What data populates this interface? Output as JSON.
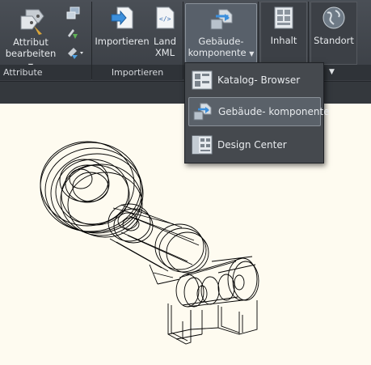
{
  "ribbon": {
    "attribute": {
      "edit_button_line1": "Attribut",
      "edit_button_line2": "bearbeiten",
      "panel_title": "Attribute"
    },
    "import": {
      "import_button": "Importieren",
      "landxml_line1": "Land",
      "landxml_line2": "XML",
      "panel_title": "Importieren"
    },
    "building_component": {
      "line1": "Gebäude-",
      "line2": "komponente"
    },
    "content_button": "Inhalt",
    "location_button": "Standort"
  },
  "dropdown": {
    "items": [
      {
        "label": "Katalog- Browser"
      },
      {
        "label": "Gebäude- komponente"
      },
      {
        "label": "Design Center"
      }
    ]
  },
  "colors": {
    "canvas_background": "#fefbf0",
    "ribbon_background": "#3f444a",
    "menu_highlight": "#5a6169"
  },
  "icons": [
    "tag-icon",
    "attribute-manager-icon",
    "attribute-sync-icon",
    "attribute-extract-icon",
    "import-icon",
    "landxml-icon",
    "building-component-icon",
    "content-icon",
    "location-globe-icon",
    "catalog-browser-icon",
    "design-center-icon"
  ]
}
